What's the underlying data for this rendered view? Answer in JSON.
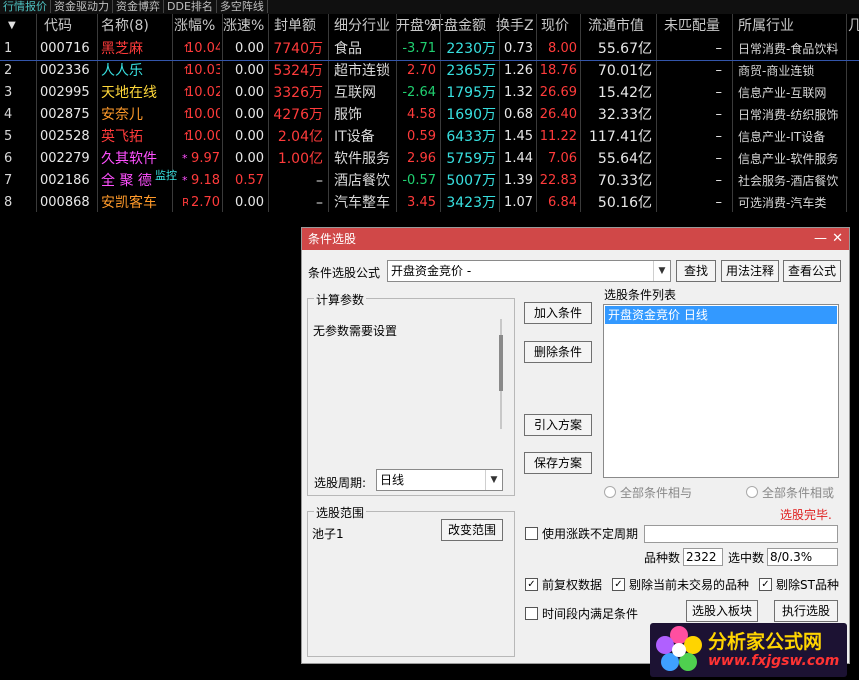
{
  "tabs": [
    "行情报价",
    "资金驱动力",
    "资金博弈",
    "DDE排名",
    "多空阵线"
  ],
  "headers": [
    "",
    "代码",
    "名称(8)",
    "涨幅%",
    "涨速%",
    "封单额",
    "细分行业",
    "开盘%",
    "开盘金额",
    "换手Z",
    "现价",
    "流通市值",
    "未匹配量",
    "所属行业",
    "几"
  ],
  "rows": [
    {
      "idx": "1",
      "code": "000716",
      "name": "黑芝麻",
      "name_color": "red",
      "flag": "↑",
      "pct": "10.04",
      "speed": "0.00",
      "seal": "7740万",
      "sub": "食品",
      "open_pct": "-3.71",
      "open_amt": "2230万",
      "turn": "0.73",
      "price": "8.00",
      "cap": "55.67亿",
      "unmatched": "–",
      "industry": "日常消费-食品饮料"
    },
    {
      "idx": "2",
      "code": "002336",
      "name": "人人乐",
      "name_color": "cyan",
      "flag": "↑",
      "pct": "10.03",
      "speed": "0.00",
      "seal": "5324万",
      "sub": "超市连锁",
      "open_pct": "2.70",
      "open_amt": "2365万",
      "turn": "1.26",
      "price": "18.76",
      "cap": "70.01亿",
      "unmatched": "–",
      "industry": "商贸-商业连锁"
    },
    {
      "idx": "3",
      "code": "002995",
      "name": "天地在线",
      "name_color": "yellow",
      "flag": "↑",
      "pct": "10.02",
      "speed": "0.00",
      "seal": "3326万",
      "sub": "互联网",
      "open_pct": "-2.64",
      "open_amt": "1795万",
      "turn": "1.32",
      "price": "26.69",
      "cap": "15.42亿",
      "unmatched": "–",
      "industry": "信息产业-互联网"
    },
    {
      "idx": "4",
      "code": "002875",
      "name": "安奈儿",
      "name_color": "orange",
      "flag": "↑",
      "pct": "10.00",
      "speed": "0.00",
      "seal": "4276万",
      "sub": "服饰",
      "open_pct": "4.58",
      "open_amt": "1690万",
      "turn": "0.68",
      "price": "26.40",
      "cap": "32.33亿",
      "unmatched": "–",
      "industry": "日常消费-纺织服饰"
    },
    {
      "idx": "5",
      "code": "002528",
      "name": "英飞拓",
      "name_color": "red",
      "flag": "↑",
      "pct": "10.00",
      "speed": "0.00",
      "seal": "2.04亿",
      "sub": "IT设备",
      "open_pct": "0.59",
      "open_amt": "6433万",
      "turn": "1.45",
      "price": "11.22",
      "cap": "117.41亿",
      "unmatched": "–",
      "industry": "信息产业-IT设备"
    },
    {
      "idx": "6",
      "code": "002279",
      "name": "久其软件",
      "name_color": "mag",
      "flag": "*",
      "pct": "9.97",
      "speed": "0.00",
      "seal": "1.00亿",
      "sub": "软件服务",
      "open_pct": "2.96",
      "open_amt": "5759万",
      "turn": "1.44",
      "price": "7.06",
      "cap": "55.64亿",
      "unmatched": "–",
      "industry": "信息产业-软件服务"
    },
    {
      "idx": "7",
      "code": "002186",
      "name": "全 聚 德",
      "name_color": "mag",
      "flag": "*",
      "pct": "9.18",
      "speed": "0.57",
      "seal": "–",
      "sub": "酒店餐饮",
      "open_pct": "-0.57",
      "open_amt": "5007万",
      "turn": "1.39",
      "price": "22.83",
      "cap": "70.33亿",
      "unmatched": "–",
      "industry": "社会服务-酒店餐饮",
      "tag": "监控"
    },
    {
      "idx": "8",
      "code": "000868",
      "name": "安凯客车",
      "name_color": "orange",
      "flag": "R",
      "pct": "2.70",
      "speed": "0.00",
      "seal": "–",
      "sub": "汽车整车",
      "open_pct": "3.45",
      "open_amt": "3423万",
      "turn": "1.07",
      "price": "6.84",
      "cap": "50.16亿",
      "unmatched": "–",
      "industry": "可选消费-汽车类"
    }
  ],
  "dialog": {
    "title": "条件选股",
    "formula_label": "条件选股公式",
    "formula_value": "开盘资金竞价 -",
    "find_btn": "查找",
    "usage_btn": "用法注释",
    "view_btn": "查看公式",
    "params_title": "计算参数",
    "params_text": "无参数需要设置",
    "period_label": "选股周期:",
    "period_value": "日线",
    "add_btn": "加入条件",
    "del_btn": "删除条件",
    "import_btn": "引入方案",
    "save_btn": "保存方案",
    "list_title": "选股条件列表",
    "list_items": [
      "开盘资金竞价  日线"
    ],
    "radio_and": "全部条件相与",
    "radio_or": "全部条件相或",
    "status": "选股完毕.",
    "range_title": "选股范围",
    "range_value": "池子1",
    "change_range_btn": "改变范围",
    "use_period_label": "使用涨跌不定周期",
    "count_label": "品种数",
    "count_value": "2322",
    "selected_label": "选中数",
    "selected_value": "8/0.3%",
    "fq_label": "前复权数据",
    "excl_untraded_label": "剔除当前未交易的品种",
    "excl_st_label": "剔除ST品种",
    "time_cond_label": "时间段内满足条件",
    "to_block_btn": "选股入板块",
    "run_btn": "执行选股"
  },
  "watermark": {
    "text": "分析家公式网",
    "url": "www.fxjgsw.com"
  }
}
